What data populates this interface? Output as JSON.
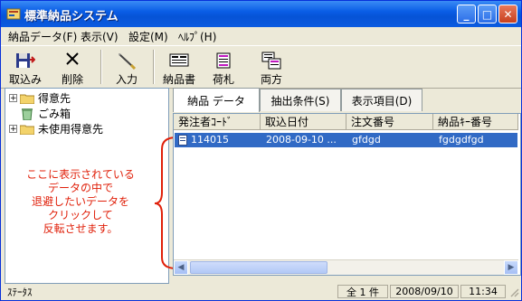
{
  "window": {
    "title": "標準納品システム"
  },
  "menu": [
    "納品データ(F)",
    "表示(V)",
    "設定(M)",
    "ﾍﾙﾌﾟ(H)"
  ],
  "toolbar": {
    "import": "取込み",
    "delete": "削除",
    "input": "入力",
    "delivery_note": "納品書",
    "tag": "荷札",
    "both": "両方"
  },
  "tree": {
    "items": [
      {
        "label": "得意先",
        "expandable": true
      },
      {
        "label": "ごみ箱",
        "expandable": false
      },
      {
        "label": "未使用得意先",
        "expandable": true
      }
    ]
  },
  "annotation": {
    "lines": [
      "ここに表示されている",
      "データの中で",
      "退避したいデータを",
      "クリックして",
      "反転させます。"
    ],
    "color": "#e0200a"
  },
  "tabs": [
    "納品 データ",
    "抽出条件(S)",
    "表示項目(D)"
  ],
  "grid": {
    "columns": [
      "発注者ｺｰﾄﾞ",
      "取込日付",
      "注文番号",
      "納品ｷｰ番号"
    ],
    "rows": [
      {
        "code": "114015",
        "date": "2008-09-10 ...",
        "order": "gfdgd",
        "key": "fgdgdfgd",
        "selected": true
      }
    ]
  },
  "status": {
    "label": "ｽﾃｰﾀｽ",
    "count": "全 1 件",
    "date": "2008/09/10",
    "time": "11:34"
  },
  "colors": {
    "selection": "#316ac5",
    "titlebar": "#0a5ee6"
  }
}
